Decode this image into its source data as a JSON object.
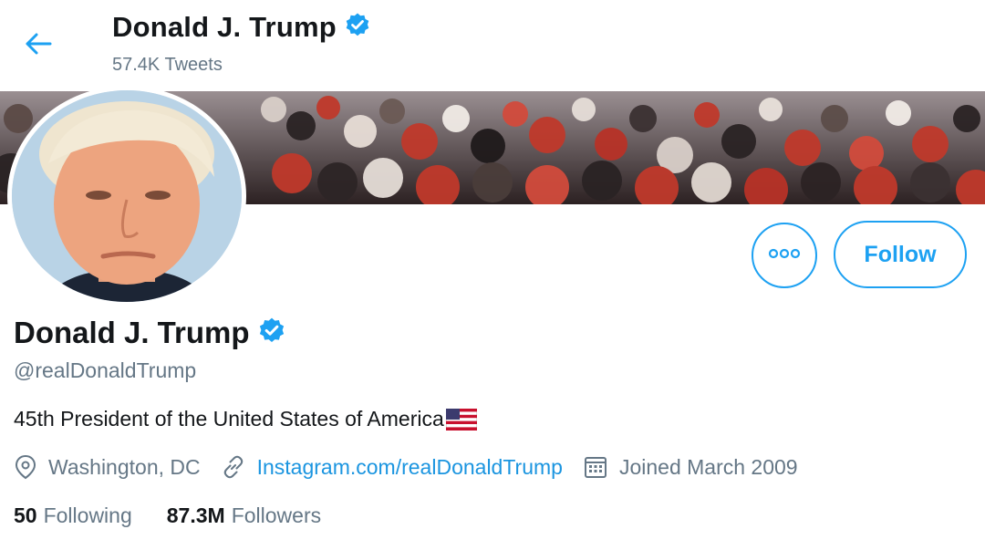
{
  "header": {
    "name": "Donald J. Trump",
    "tweet_count": "57.4K Tweets"
  },
  "profile": {
    "name": "Donald J. Trump",
    "handle": "@realDonaldTrump",
    "bio": "45th President of the United States of America",
    "location": "Washington, DC",
    "website": "Instagram.com/realDonaldTrump",
    "joined": "Joined March 2009"
  },
  "actions": {
    "follow_label": "Follow",
    "more_icon": "more-horizontal-icon"
  },
  "stats": {
    "following_count": "50",
    "following_label": "Following",
    "followers_count": "87.3M",
    "followers_label": "Followers"
  },
  "icons": {
    "back": "back-arrow-icon",
    "verified": "verified-badge-icon",
    "location": "location-pin-icon",
    "link": "link-icon",
    "calendar": "calendar-icon",
    "flag": "us-flag-emoji"
  },
  "colors": {
    "accent": "#1da1f2",
    "link": "#1b95e0",
    "text": "#14171a",
    "secondary": "#657786"
  }
}
